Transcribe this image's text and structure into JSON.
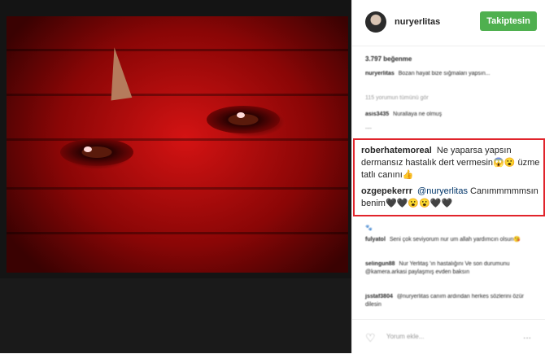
{
  "header": {
    "username": "nuryerlitas",
    "follow_label": "Takiptesin"
  },
  "likes": "3.797 beğenme",
  "comments_blurred": [
    {
      "user": "nuryerlitas",
      "text": "Bozan hayat bize sığmaları yapsın..."
    },
    {
      "user": "",
      "text": "115 yorumun tümünü gör"
    },
    {
      "user": "asis3435",
      "text": "Nurallaya ne olmuş"
    },
    {
      "user": "",
      "text": "...."
    }
  ],
  "highlighted": [
    {
      "user": "roberhatemoreal",
      "text": "Ne yaparsa yapsın dermansız hastalık dert vermesin😱😮 üzme tatlı canını👍",
      "mention": ""
    },
    {
      "user": "ozgepekerrr",
      "mention": "@nuryerlitas",
      "text": "Canımmmmmsın benim🖤🖤😮😮🖤🖤"
    }
  ],
  "comments_after": [
    {
      "user": "",
      "text": "🐾"
    },
    {
      "user": "fulyatol",
      "text": "Seni çok seviyorum nur um allah yardımcın olsun😘"
    },
    {
      "user": "selingun88",
      "text": "Nur Yerlitaş 'ın hastalığını Ve son durumunu @kamera.arkasi paylaşmış evden baksın"
    },
    {
      "user": "jsstaf3804",
      "text": "@nuryerlitas canım ardından herkes sözlerini özür dilesin"
    }
  ],
  "footer": {
    "comment_placeholder": "Yorum ekle...",
    "more_label": "..."
  }
}
